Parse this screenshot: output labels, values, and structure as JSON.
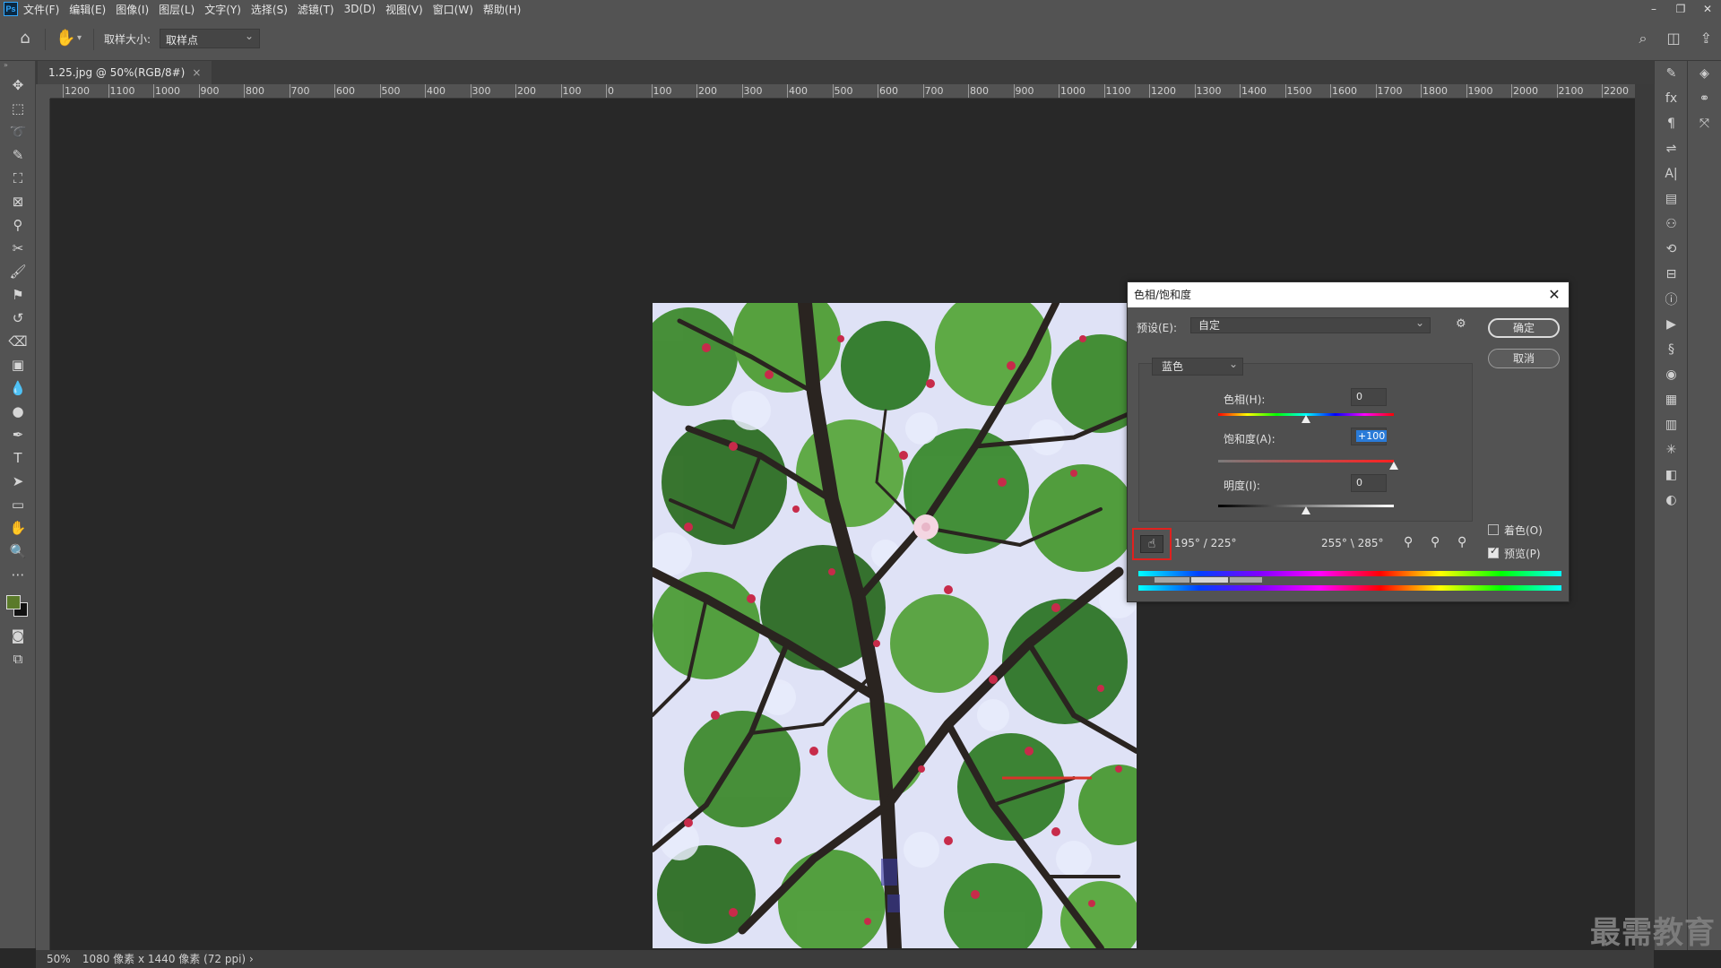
{
  "app": {
    "logo": "Ps",
    "menu": [
      "文件(F)",
      "编辑(E)",
      "图像(I)",
      "图层(L)",
      "文字(Y)",
      "选择(S)",
      "滤镜(T)",
      "3D(D)",
      "视图(V)",
      "窗口(W)",
      "帮助(H)"
    ]
  },
  "options": {
    "sample_size_label": "取样大小:",
    "sample_size_value": "取样点"
  },
  "document": {
    "tab_title": "1.25.jpg @ 50%(RGB/8#)",
    "tab_close": "×"
  },
  "ruler_labels": [
    "1200",
    "1100",
    "1000",
    "900",
    "800",
    "700",
    "600",
    "500",
    "400",
    "300",
    "200",
    "100",
    "0",
    "100",
    "200",
    "300",
    "400",
    "500",
    "600",
    "700",
    "800",
    "900",
    "1000",
    "1100",
    "1200",
    "1300",
    "1400",
    "1500",
    "1600",
    "1700",
    "1800",
    "1900",
    "2000",
    "2100",
    "2200"
  ],
  "status": {
    "zoom": "50%",
    "info": "1080 像素 x 1440 像素 (72 ppi)"
  },
  "dialog": {
    "title": "色相/饱和度",
    "preset_label": "预设(E):",
    "preset_value": "自定",
    "ok_label": "确定",
    "cancel_label": "取消",
    "channel": "蓝色",
    "hue_label": "色相(H):",
    "hue_value": "0",
    "saturation_label": "饱和度(A):",
    "saturation_value": "+100",
    "lightness_label": "明度(I):",
    "lightness_value": "0",
    "range_left": "195° / 225°",
    "range_right": "255° \\ 285°",
    "colorize_label": "着色(O)",
    "colorize_checked": false,
    "preview_label": "预览(P)",
    "preview_checked": true
  },
  "watermark": "最需教育",
  "colors": {
    "foreground_swatch": "#5a7a2a",
    "background_swatch": "#111111",
    "highlight": "#e0211f"
  }
}
